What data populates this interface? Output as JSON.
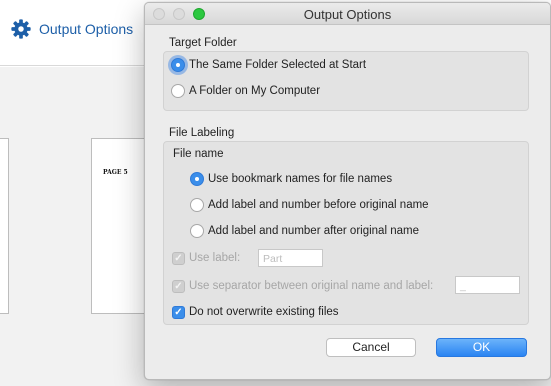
{
  "background": {
    "toolbar_title": "Output Options",
    "page_label": "PAGE 5"
  },
  "dialog": {
    "title": "Output Options",
    "target_folder": {
      "label": "Target Folder",
      "options": [
        {
          "label": "The Same Folder Selected at Start",
          "selected": true
        },
        {
          "label": "A Folder on My Computer",
          "selected": false
        }
      ]
    },
    "file_labeling": {
      "label": "File Labeling",
      "file_name_label": "File name",
      "options": [
        {
          "label": "Use bookmark names for file names",
          "selected": true
        },
        {
          "label": "Add label and number before original name",
          "selected": false
        },
        {
          "label": "Add label and number after original name",
          "selected": false
        }
      ],
      "use_label": {
        "label": "Use label:",
        "checked": true,
        "disabled": true,
        "value": "Part"
      },
      "use_separator": {
        "label": "Use separator between original name and label:",
        "checked": true,
        "disabled": true,
        "value": "_"
      },
      "no_overwrite": {
        "label": "Do not overwrite existing files",
        "checked": true
      }
    },
    "buttons": {
      "cancel": "Cancel",
      "ok": "OK"
    }
  },
  "colors": {
    "accent": "#3b8eea",
    "title_blue": "#1d5fa8",
    "zoom_green": "#2cc840"
  }
}
